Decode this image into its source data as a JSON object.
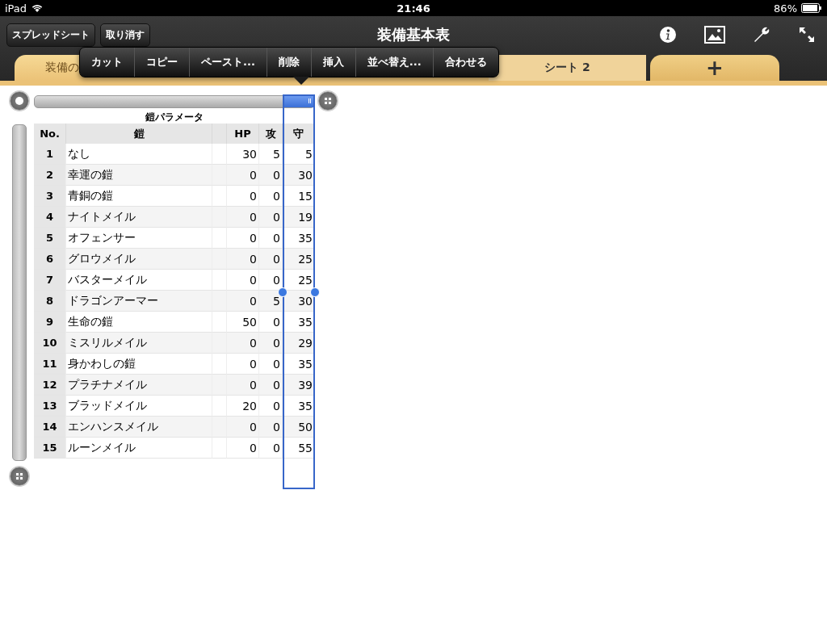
{
  "status_bar": {
    "device": "iPad",
    "time": "21:46",
    "battery": "86%"
  },
  "toolbar": {
    "buttons": [
      "スプレッドシート",
      "取り消す"
    ],
    "title": "装備基本表"
  },
  "tabs": [
    {
      "label": "装備の",
      "selected": true
    },
    {
      "label": "シート 2",
      "selected": false
    }
  ],
  "add_tab": "+",
  "edit_menu": [
    "カット",
    "コピー",
    "ペースト...",
    "削除",
    "挿入",
    "並べ替え...",
    "合わせる"
  ],
  "table": {
    "title": "鎧パラメータ",
    "columns": [
      {
        "label": "No.",
        "selected": false
      },
      {
        "label": "鎧",
        "selected": false
      },
      {
        "label": "HP",
        "selected": false
      },
      {
        "label": "攻",
        "selected": false
      },
      {
        "label": "守",
        "selected": true
      }
    ],
    "rows": [
      {
        "no": "1",
        "name": "なし",
        "hp": "30",
        "atk": "5",
        "def": "5"
      },
      {
        "no": "2",
        "name": "幸運の鎧",
        "hp": "0",
        "atk": "0",
        "def": "30"
      },
      {
        "no": "3",
        "name": "青銅の鎧",
        "hp": "0",
        "atk": "0",
        "def": "15"
      },
      {
        "no": "4",
        "name": "ナイトメイル",
        "hp": "0",
        "atk": "0",
        "def": "19"
      },
      {
        "no": "5",
        "name": "オフェンサー",
        "hp": "0",
        "atk": "0",
        "def": "35"
      },
      {
        "no": "6",
        "name": "グロウメイル",
        "hp": "0",
        "atk": "0",
        "def": "25"
      },
      {
        "no": "7",
        "name": "バスターメイル",
        "hp": "0",
        "atk": "0",
        "def": "25"
      },
      {
        "no": "8",
        "name": "ドラゴンアーマー",
        "hp": "0",
        "atk": "5",
        "def": "30"
      },
      {
        "no": "9",
        "name": "生命の鎧",
        "hp": "50",
        "atk": "0",
        "def": "35"
      },
      {
        "no": "10",
        "name": "ミスリルメイル",
        "hp": "0",
        "atk": "0",
        "def": "29"
      },
      {
        "no": "11",
        "name": "身かわしの鎧",
        "hp": "0",
        "atk": "0",
        "def": "35"
      },
      {
        "no": "12",
        "name": "プラチナメイル",
        "hp": "0",
        "atk": "0",
        "def": "39"
      },
      {
        "no": "13",
        "name": "ブラッドメイル",
        "hp": "20",
        "atk": "0",
        "def": "35"
      },
      {
        "no": "14",
        "name": "エンハンスメイル",
        "hp": "0",
        "atk": "0",
        "def": "50"
      },
      {
        "no": "15",
        "name": "ルーンメイル",
        "hp": "0",
        "atk": "0",
        "def": "55"
      }
    ]
  }
}
